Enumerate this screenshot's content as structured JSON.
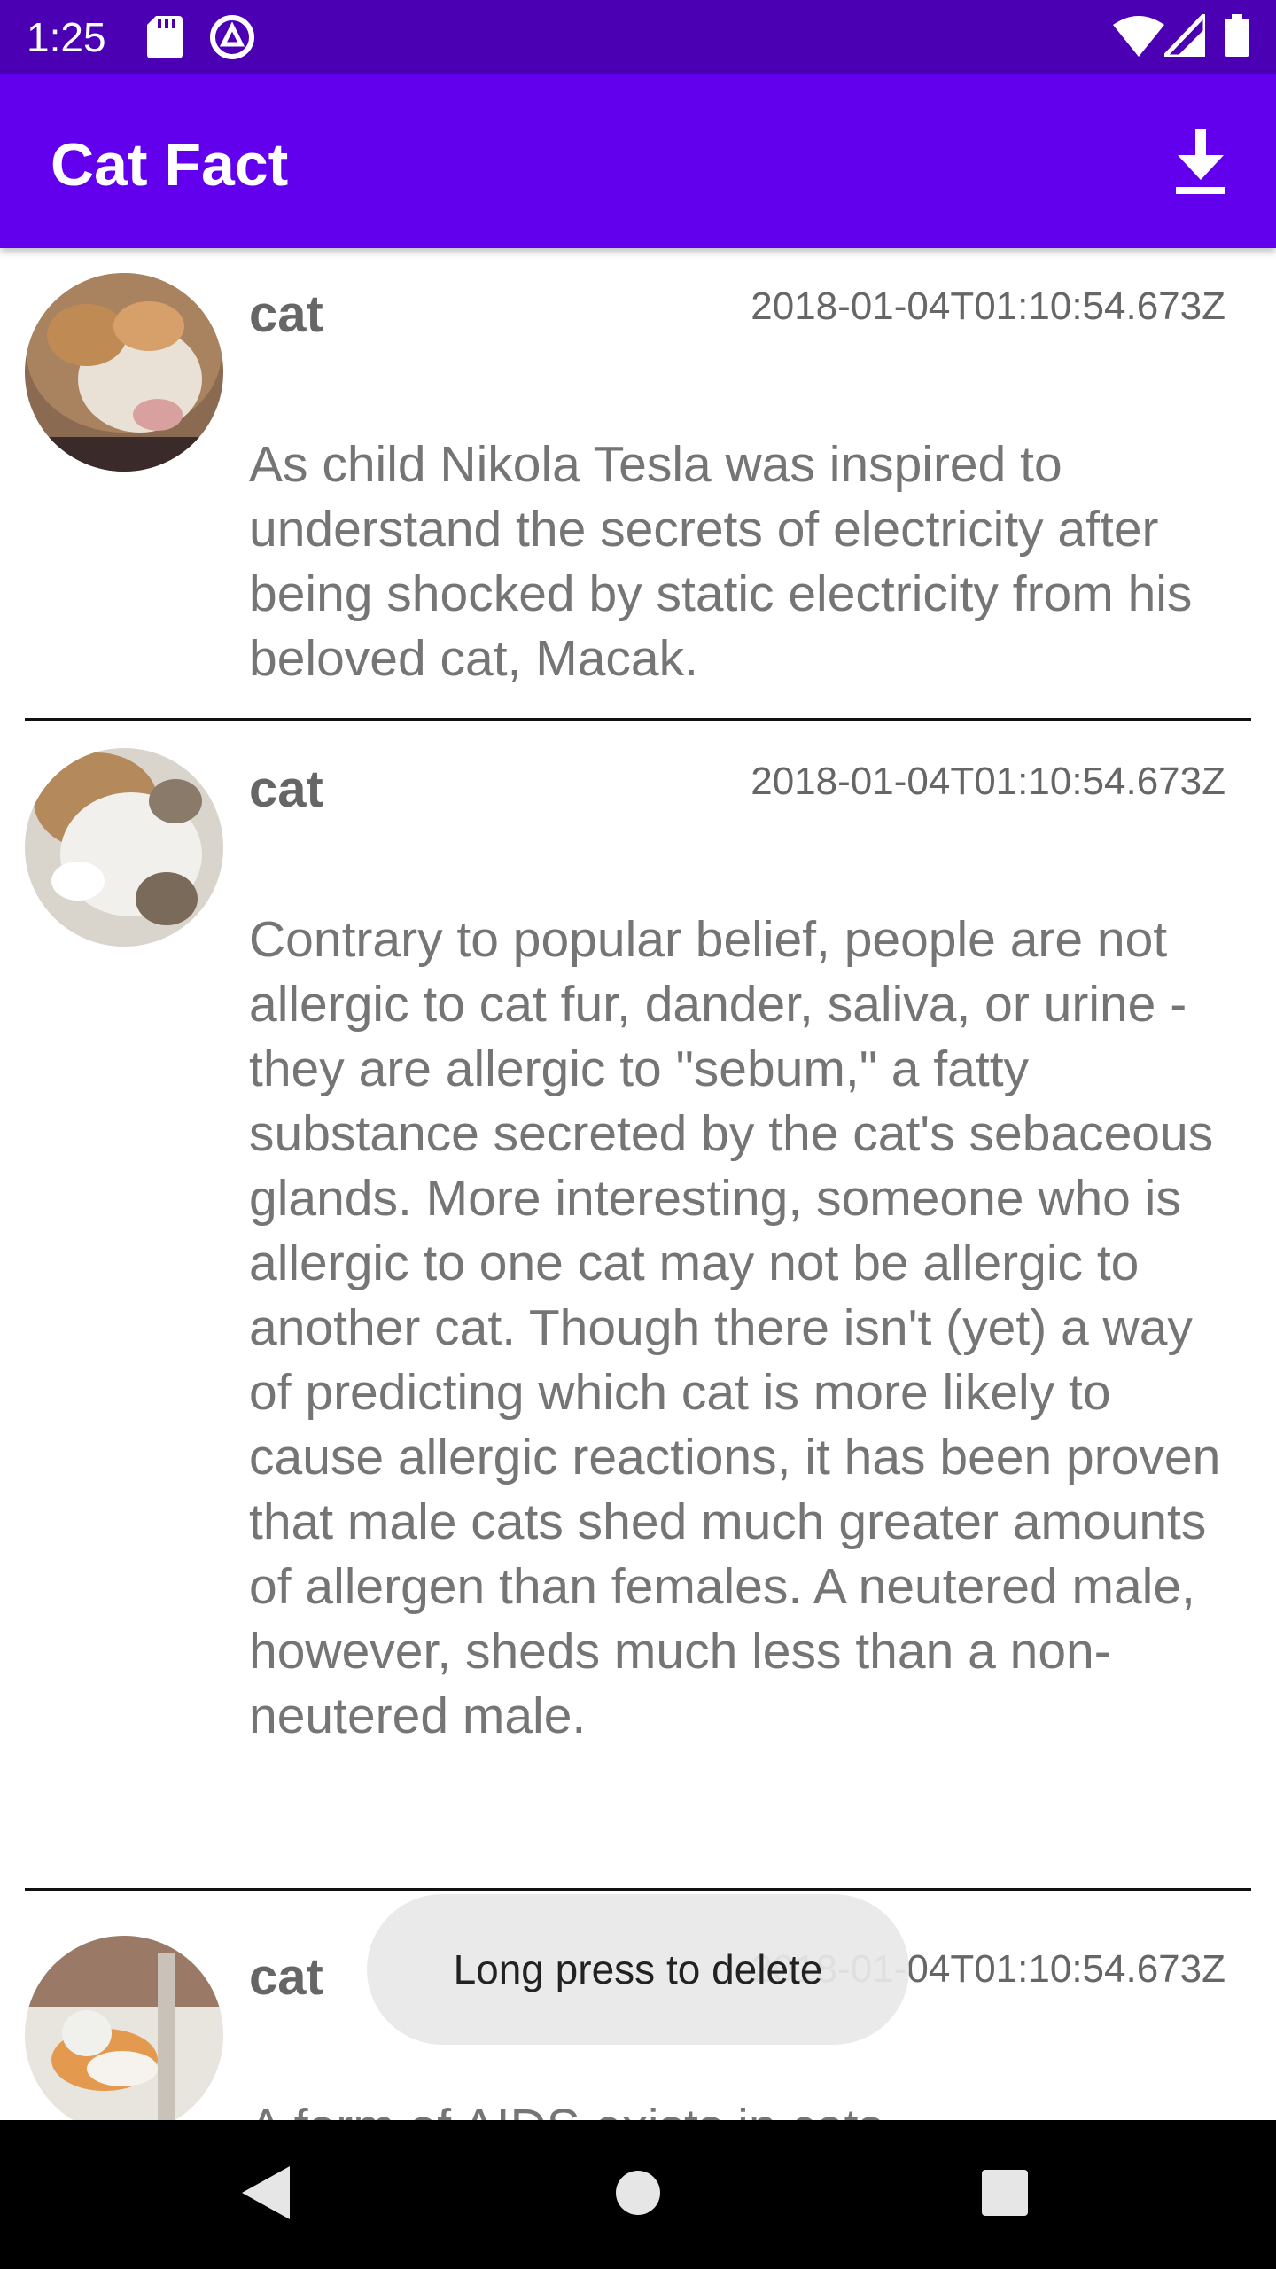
{
  "status_bar": {
    "time": "1:25",
    "icons": [
      "sd-card-icon",
      "sync-icon",
      "wifi-icon",
      "signal-icon",
      "battery-icon"
    ]
  },
  "app_bar": {
    "title": "Cat Fact",
    "action_icon": "download-icon"
  },
  "facts": [
    {
      "type": "cat",
      "date": "2018-01-04T01:10:54.673Z",
      "text": "As child Nikola Tesla was inspired to understand the secrets of electricity after being shocked by static electricity from his beloved cat, Macak.",
      "avatar_icon": "cat-photo-sleeping"
    },
    {
      "type": "cat",
      "date": "2018-01-04T01:10:54.673Z",
      "text": "Contrary to popular belief, people are not allergic to cat fur, dander, saliva, or urine - they are allergic to \"sebum,\" a fatty substance secreted by the cat's sebaceous glands. More interesting, someone who is allergic to one cat may not be allergic to another cat. Though there isn't (yet) a way of predicting which cat is more likely to cause allergic reactions, it has been proven that male cats shed much greater amounts of allergen than females. A neutered male, however, sheds much less than a non-neutered male.",
      "avatar_icon": "cat-photo-belly"
    },
    {
      "type": "cat",
      "date": "2018-01-04T01:10:54.673Z",
      "text": "A form of AIDS exists in cats.",
      "avatar_icon": "cat-photo-kitten"
    }
  ],
  "toast": {
    "message": "Long press to delete"
  },
  "nav_bar": {
    "buttons": [
      "back-icon",
      "home-icon",
      "recents-icon"
    ]
  },
  "colors": {
    "status_bar": "#4b00b3",
    "app_bar": "#6200ee",
    "text_gray": "#757575"
  }
}
